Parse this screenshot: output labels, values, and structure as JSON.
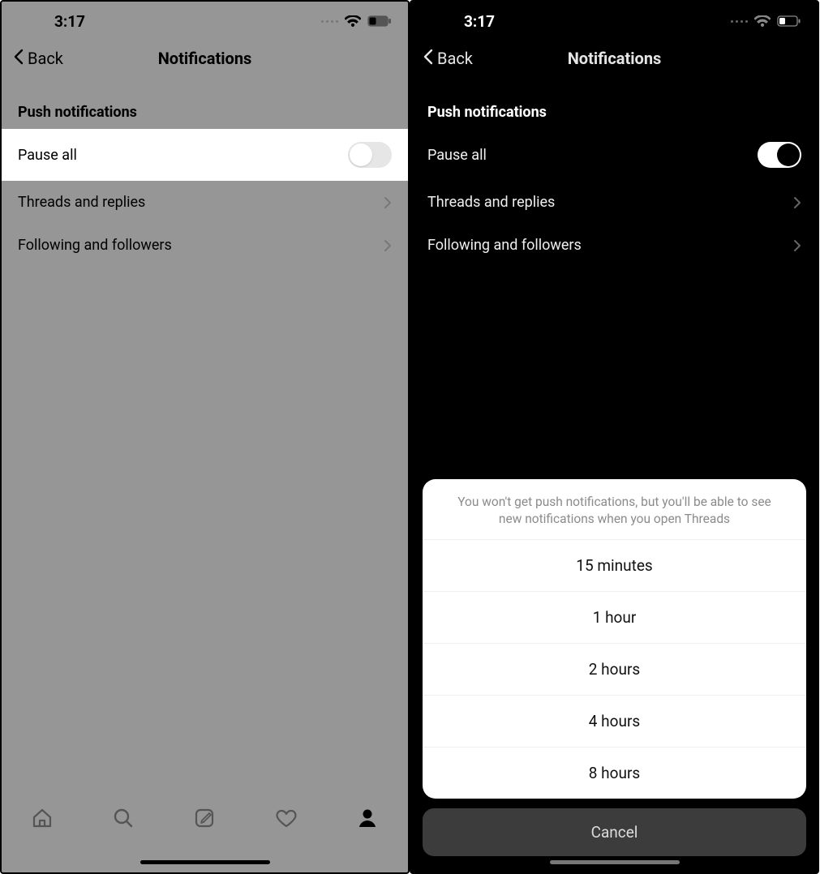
{
  "status": {
    "time": "3:17"
  },
  "nav": {
    "back": "Back",
    "title": "Notifications"
  },
  "section": {
    "push_header": "Push notifications"
  },
  "rows": {
    "pause_all": "Pause all",
    "threads_replies": "Threads and replies",
    "following_followers": "Following and followers"
  },
  "sheet": {
    "message": "You won't get push notifications, but you'll be able to see new notifications when you open Threads",
    "options": [
      "15 minutes",
      "1 hour",
      "2 hours",
      "4 hours",
      "8 hours"
    ],
    "cancel": "Cancel"
  },
  "tabs": {
    "home": "home-icon",
    "search": "search-icon",
    "compose": "compose-icon",
    "activity": "heart-icon",
    "profile": "profile-icon"
  }
}
